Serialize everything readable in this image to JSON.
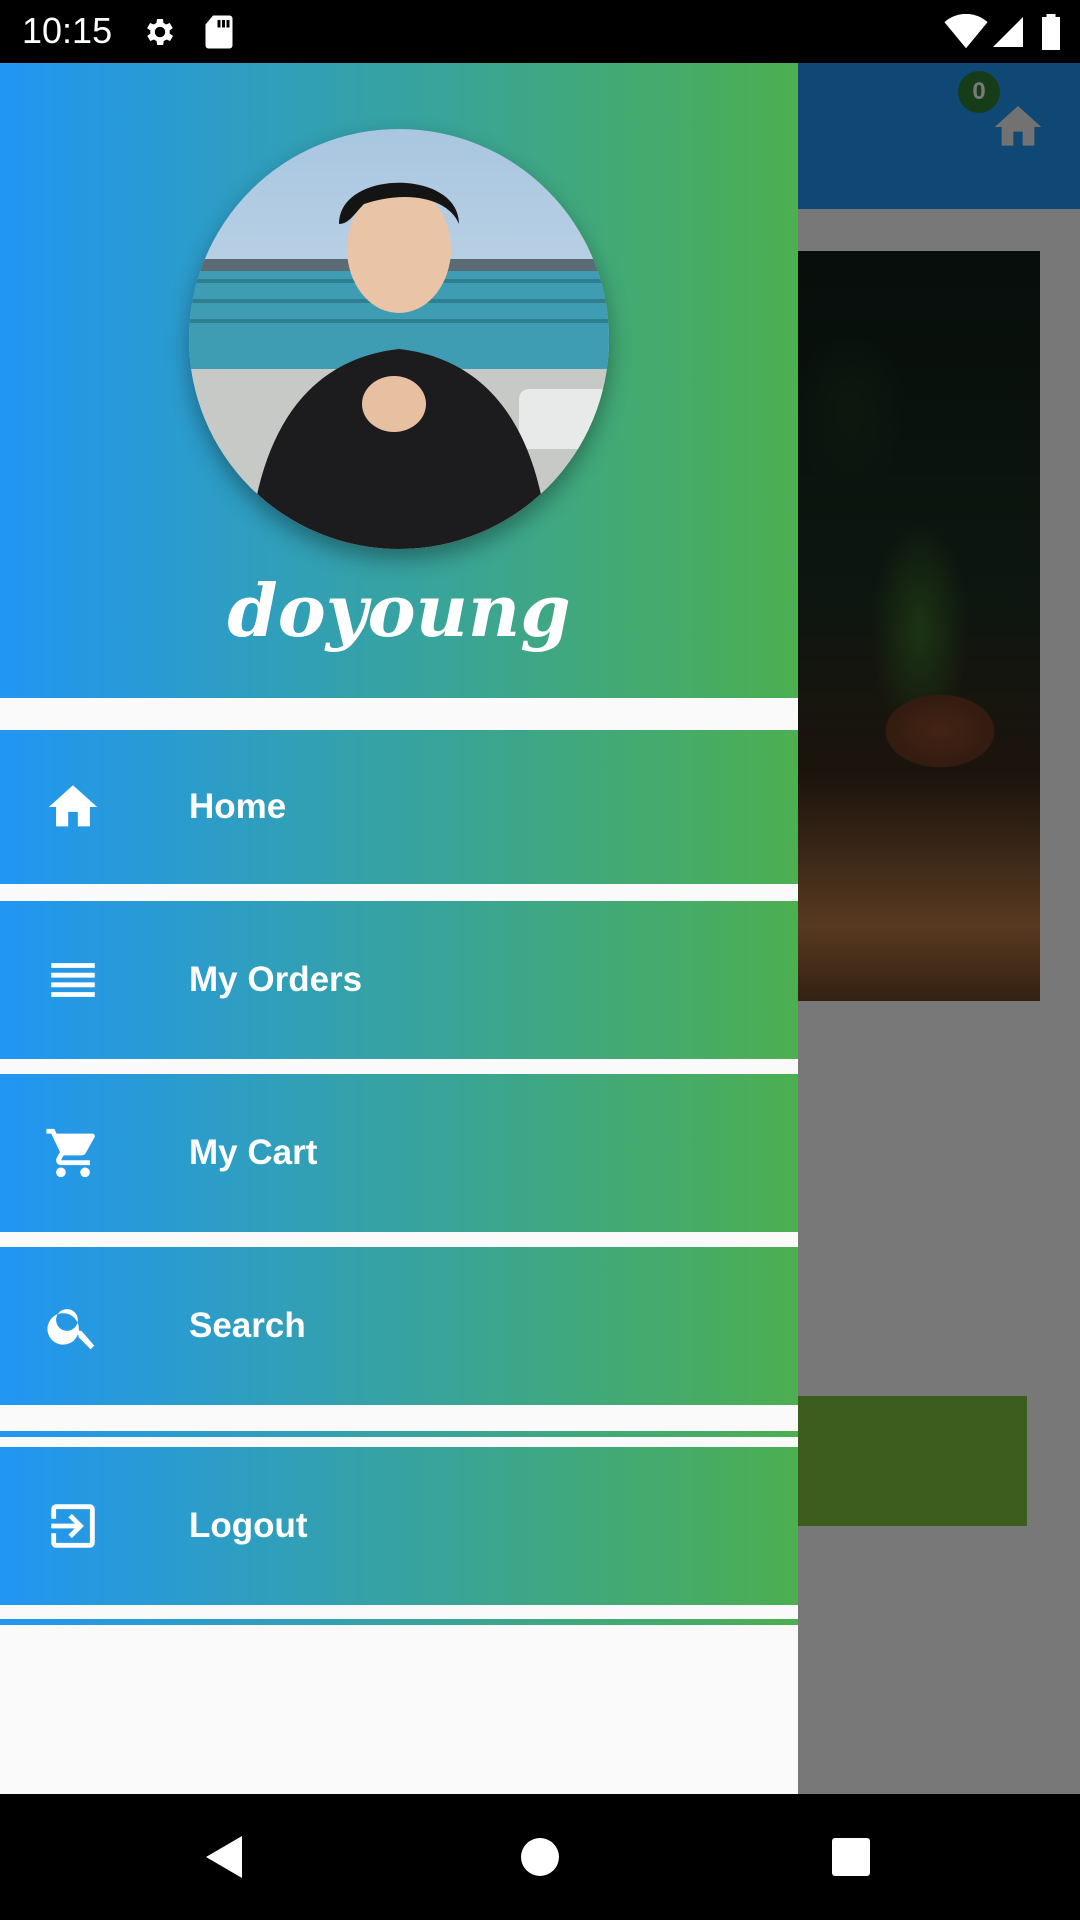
{
  "status_bar": {
    "time": "10:15",
    "icons": [
      "settings-icon",
      "sd-card-icon",
      "wifi-icon",
      "signal-icon",
      "battery-icon"
    ]
  },
  "background_app": {
    "cart_count": "0",
    "toolbar_icon": "home-icon"
  },
  "drawer": {
    "user_name": "doyoung",
    "items": [
      {
        "label": "Home",
        "icon": "home-icon"
      },
      {
        "label": "My Orders",
        "icon": "list-icon"
      },
      {
        "label": "My Cart",
        "icon": "cart-icon"
      },
      {
        "label": "Search",
        "icon": "search-icon"
      },
      {
        "label": "Logout",
        "icon": "logout-icon"
      }
    ]
  },
  "colors": {
    "gradient_start": "#2196f3",
    "gradient_end": "#4caf50",
    "drawer_background": "#fafafa"
  },
  "nav_bar": {
    "buttons": [
      "back-icon",
      "home-circle-icon",
      "recents-icon"
    ]
  }
}
